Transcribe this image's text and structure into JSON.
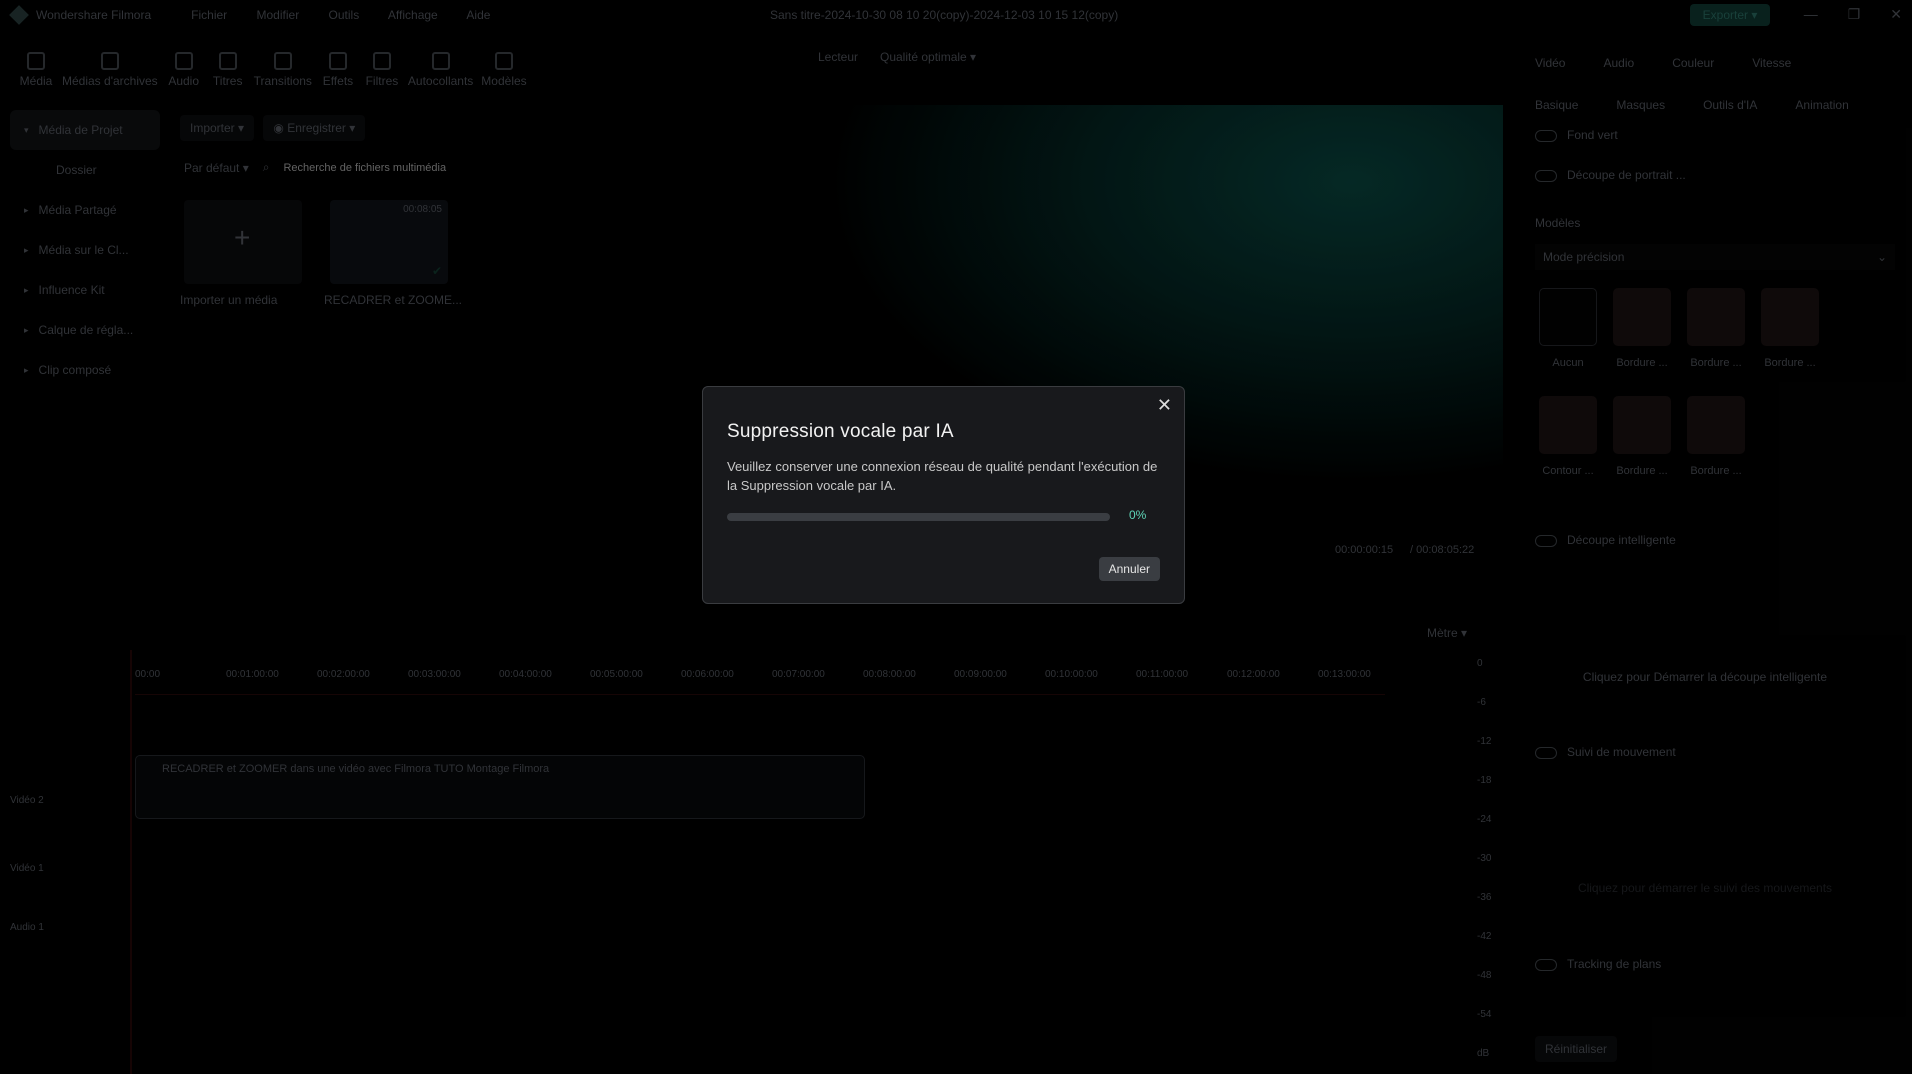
{
  "app": {
    "name": "Wondershare Filmora",
    "project_title": "Sans titre-2024-10-30 08 10 20(copy)-2024-12-03 10 15 12(copy)",
    "export_label": "Exporter"
  },
  "menu": [
    "Fichier",
    "Modifier",
    "Outils",
    "Affichage",
    "Aide"
  ],
  "tools": [
    {
      "label": "Média",
      "icon": "media-icon"
    },
    {
      "label": "Médias d'archives",
      "icon": "stock-icon"
    },
    {
      "label": "Audio",
      "icon": "music-icon"
    },
    {
      "label": "Titres",
      "icon": "text-icon"
    },
    {
      "label": "Transitions",
      "icon": "transition-icon"
    },
    {
      "label": "Effets",
      "icon": "effects-icon"
    },
    {
      "label": "Filtres",
      "icon": "filter-icon"
    },
    {
      "label": "Autocollants",
      "icon": "sticker-icon"
    },
    {
      "label": "Modèles",
      "icon": "template-icon"
    }
  ],
  "sidebar": {
    "items": [
      "Média de Projet",
      "Dossier",
      "Média Partagé",
      "Média sur le Cl...",
      "Influence Kit",
      "Calque de régla...",
      "Clip composé"
    ]
  },
  "media": {
    "import_label": "Importer",
    "record_label": "Enregistrer",
    "sort_label": "Par défaut",
    "search_placeholder": "Recherche de fichiers multimédia",
    "import_card": "Importer un média",
    "clip_card": "RECADRER et ZOOME...",
    "clip_duration": "00:08:05"
  },
  "preview": {
    "player_label": "Lecteur",
    "quality_label": "Qualité optimale",
    "current_time": "00:00:00:15",
    "total_time": "00:08:05:22"
  },
  "right": {
    "tabs": [
      "Vidéo",
      "Audio",
      "Couleur",
      "Vitesse"
    ],
    "subtabs": [
      "Basique",
      "Masques",
      "Outils d'IA",
      "Animation"
    ],
    "fond_vert": "Fond vert",
    "portrait": "Découpe de portrait ...",
    "models_label": "Modèles",
    "mode": "Mode précision",
    "thumbs": [
      "Aucun",
      "Bordure ...",
      "Bordure ...",
      "Bordure ...",
      "Contour ...",
      "Bordure ...",
      "Bordure ..."
    ],
    "smart_cut": "Découpe intelligente",
    "smart_cut_hint": "Cliquez pour Démarrer la découpe intelligente",
    "motion": "Suivi de mouvement",
    "motion_hint": "Cliquez pour démarrer le suivi des mouvements",
    "planar": "Tracking de plans",
    "reset": "Réinitialiser"
  },
  "timeline": {
    "ruler": [
      "00:00",
      "00:01:00:00",
      "00:02:00:00",
      "00:03:00:00",
      "00:04:00:00",
      "00:05:00:00",
      "00:06:00:00",
      "00:07:00:00",
      "00:08:00:00",
      "00:09:00:00",
      "00:10:00:00",
      "00:11:00:00",
      "00:12:00:00",
      "00:13:00:00"
    ],
    "tracks": [
      "Vidéo 2",
      "Vidéo 1",
      "Audio 1"
    ],
    "clip_title": "RECADRER et ZOOMER dans une vidéo avec Filmora  TUTO Montage Filmora",
    "meter_label": "Mètre",
    "meter_ticks": [
      "0",
      "-6",
      "-12",
      "-18",
      "-24",
      "-30",
      "-36",
      "-42",
      "-48",
      "-54",
      "dB"
    ]
  },
  "dialog": {
    "title": "Suppression vocale par IA",
    "message": "Veuillez conserver une connexion réseau de qualité pendant l'exécution de la Suppression vocale par IA.",
    "progress_percent": 0,
    "progress_label": "0%",
    "cancel_label": "Annuler",
    "accent": "#38d1b2"
  }
}
